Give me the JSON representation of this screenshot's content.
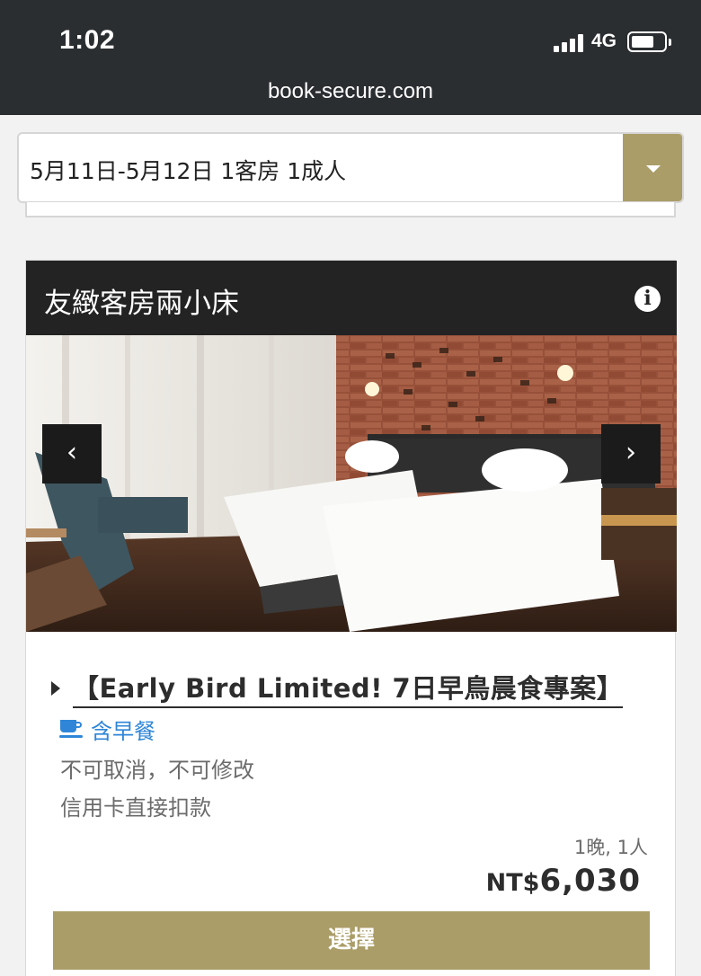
{
  "status_bar": {
    "time": "1:02",
    "network": "4G"
  },
  "browser": {
    "url": "book-secure.com"
  },
  "search": {
    "summary": "5月11日-5月12日  1客房 1成人"
  },
  "room": {
    "name": "友緻客房兩小床",
    "plan": {
      "title": "【Early Bird Limited! 7日早鳥晨食專案】",
      "meal": "含早餐",
      "policy_cancel": "不可取消，不可修改",
      "policy_payment": "信用卡直接扣款",
      "per_unit": "1晚, 1人",
      "currency": "NT$",
      "price": "6,030",
      "select_label": "選擇"
    }
  },
  "icons": {
    "info": "info-icon",
    "dropdown": "chevron-down-icon",
    "prev": "chevron-left-icon",
    "next": "chevron-right-icon",
    "meal": "coffee-cup-icon",
    "expand": "triangle-right-icon"
  },
  "colors": {
    "accent": "#ab9d68",
    "header_dark": "#232323",
    "link_blue": "#2f86d8",
    "status_bar": "#2b2e31"
  }
}
